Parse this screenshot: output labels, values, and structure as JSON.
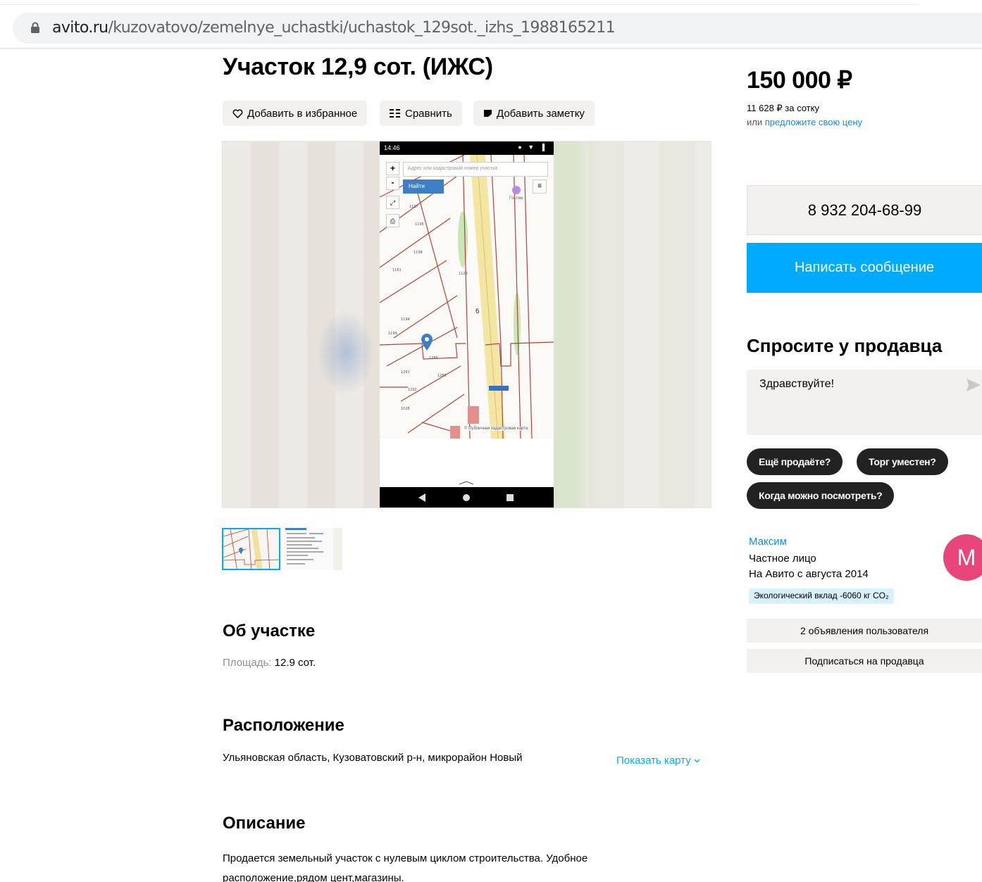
{
  "browser": {
    "url_host": "avito.ru",
    "url_path": "/kuzovatovo/zemelnye_uchastki/uchastok_129sot._izhs_1988165211"
  },
  "listing": {
    "title": "Участок 12,9 сот. (ИЖС)",
    "actions": {
      "favorite": "Добавить в избранное",
      "compare": "Сравнить",
      "note": "Добавить заметку"
    },
    "gallery": {
      "status_time": "14:46",
      "map_search_placeholder": "Адрес или кадастровый номер участка",
      "map_search_button": "Найти",
      "map_attribution": "© Публичная кадастровая карта",
      "map_label_guest": "Гостям"
    },
    "about": {
      "heading": "Об участке",
      "area_label": "Площадь:",
      "area_value": "12.9 сот."
    },
    "location": {
      "heading": "Расположение",
      "address": "Ульяновская область, Кузоватовский р-н, микрорайон Новый",
      "show_map": "Показать карту"
    },
    "description": {
      "heading": "Описание",
      "text": "Продается земельный участок с нулевым циклом строительства. Удобное расположение,рядом цент,магазины."
    }
  },
  "sidebar": {
    "price": "150 000 ₽",
    "price_per_unit": "11 628 ₽ за сотку",
    "offer_prefix": "или",
    "offer_link": "предложите свою цену",
    "phone": "8 932 204-68-99",
    "write_message": "Написать сообщение",
    "ask_title": "Спросите у продавца",
    "ask_input_value": "Здравствуйте!",
    "quick_replies": [
      "Ещё продаёте?",
      "Торг уместен?",
      "Когда можно посмотреть?"
    ],
    "seller": {
      "name": "Максим",
      "type": "Частное лицо",
      "since": "На Авито с августа 2014",
      "eco": "Экологический вклад -6060 кг CO₂",
      "avatar_letter": "М",
      "listings_button": "2 объявления пользователя",
      "subscribe_button": "Подписаться на продавца"
    }
  },
  "colors": {
    "accent_blue": "#00aaff",
    "link_blue": "#0a8ee8",
    "avatar_pink": "#e8467a",
    "chip_dark": "#222222",
    "button_gray": "#f2f1f0"
  },
  "icons": [
    "lock-icon",
    "heart-icon",
    "compare-icon",
    "note-icon",
    "send-icon",
    "chevron-down-icon",
    "map-pin-icon",
    "back-icon",
    "home-icon",
    "recents-icon"
  ]
}
